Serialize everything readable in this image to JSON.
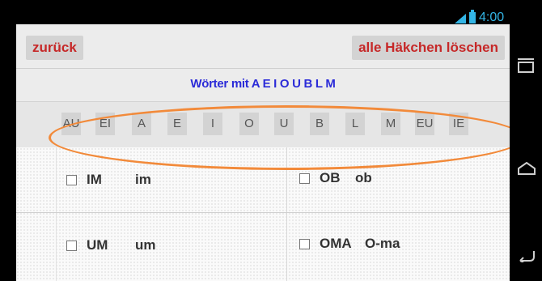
{
  "status_bar": {
    "time": "4:00",
    "accent_color": "#33b5e5"
  },
  "toolbar": {
    "back_label": "zurück",
    "clear_label": "alle Häkchen löschen"
  },
  "title": "Wörter mit A E I O U B L M",
  "letter_buttons": [
    "AU",
    "EI",
    "A",
    "E",
    "I",
    "O",
    "U",
    "B",
    "L",
    "M",
    "EU",
    "IE"
  ],
  "words": [
    {
      "word": "IM",
      "syllables": "im",
      "checked": false
    },
    {
      "word": "OB",
      "syllables": "ob",
      "checked": false
    },
    {
      "word": "UM",
      "syllables": "um",
      "checked": false
    },
    {
      "word": "OMA",
      "syllables": "O-ma",
      "checked": false
    }
  ],
  "nav_icons": [
    "recent-apps-icon",
    "home-icon",
    "back-icon"
  ],
  "annotation_color": "#f28a3a"
}
